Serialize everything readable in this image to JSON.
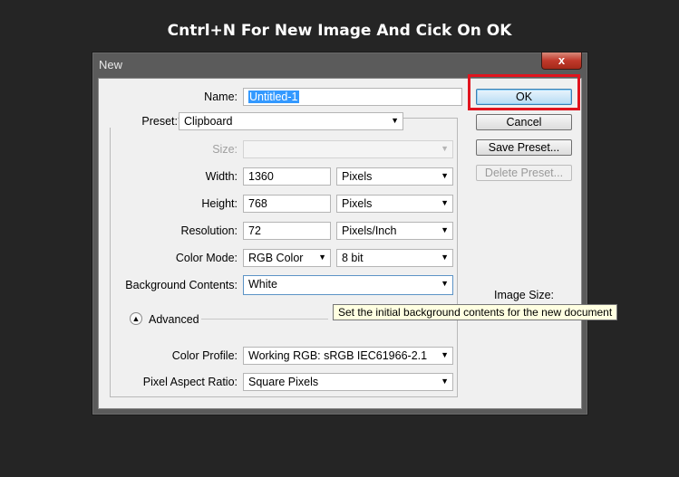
{
  "caption": "Cntrl+N For New Image And Cick On OK",
  "window": {
    "title": "New",
    "close_glyph": "x"
  },
  "form": {
    "name_label": "Name:",
    "name_value": "Untitled-1",
    "preset_label": "Preset:",
    "preset_value": "Clipboard",
    "size_label": "Size:",
    "size_value": "",
    "width_label": "Width:",
    "width_value": "1360",
    "width_unit": "Pixels",
    "height_label": "Height:",
    "height_value": "768",
    "height_unit": "Pixels",
    "resolution_label": "Resolution:",
    "resolution_value": "72",
    "resolution_unit": "Pixels/Inch",
    "color_mode_label": "Color Mode:",
    "color_mode_value": "RGB Color",
    "bit_depth_value": "8 bit",
    "bg_label": "Background Contents:",
    "bg_value": "White",
    "advanced_label": "Advanced",
    "color_profile_label": "Color Profile:",
    "color_profile_value": "Working RGB:  sRGB IEC61966-2.1",
    "pixel_aspect_label": "Pixel Aspect Ratio:",
    "pixel_aspect_value": "Square Pixels"
  },
  "buttons": {
    "ok": "OK",
    "cancel": "Cancel",
    "save_preset": "Save Preset...",
    "delete_preset": "Delete Preset..."
  },
  "image_size_label": "Image Size:",
  "tooltip": "Set the initial background contents for the new document",
  "colors": {
    "highlight": "#e0141e",
    "selection": "#3399ff"
  },
  "icons": {
    "dropdown": "chevron-down-icon",
    "advanced": "expand-up-icon"
  }
}
